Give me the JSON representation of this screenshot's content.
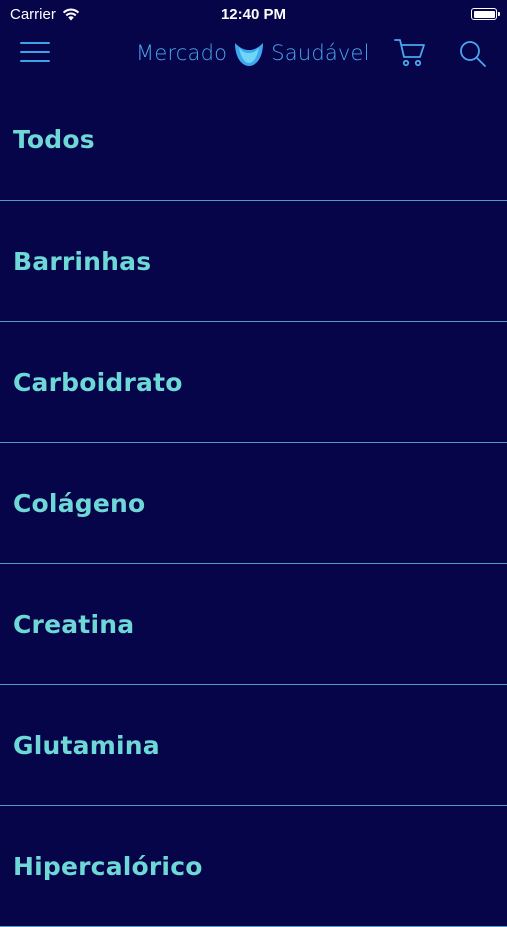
{
  "status_bar": {
    "carrier": "Carrier",
    "time": "12:40 PM"
  },
  "header": {
    "brand_left": "Mercado",
    "brand_right": "Saudável",
    "menu_icon": "hamburger-icon",
    "cart_icon": "cart-icon",
    "search_icon": "search-icon",
    "accent_color": "#4aa6ee"
  },
  "categories": [
    {
      "label": "Todos"
    },
    {
      "label": "Barrinhas"
    },
    {
      "label": "Carboidrato"
    },
    {
      "label": "Colágeno"
    },
    {
      "label": "Creatina"
    },
    {
      "label": "Glutamina"
    },
    {
      "label": "Hipercalórico"
    }
  ],
  "colors": {
    "background": "#07054a",
    "category_text": "#6ed8d6",
    "divider": "#4f9bc4"
  }
}
